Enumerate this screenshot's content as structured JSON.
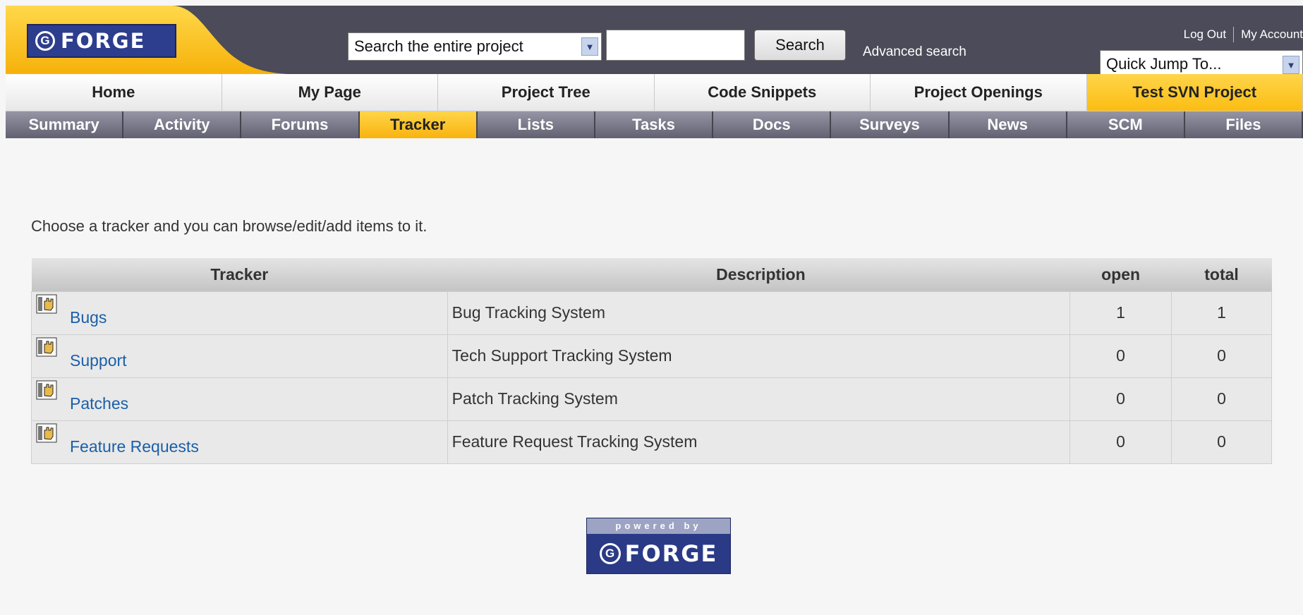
{
  "brand": {
    "logo_mark": "G",
    "logo_text": "FORGE"
  },
  "search": {
    "scope_selected": "Search the entire project",
    "query": "",
    "button_label": "Search",
    "advanced_link": "Advanced search"
  },
  "account": {
    "logout": "Log Out",
    "my_account": "My Account",
    "quick_jump": "Quick Jump To..."
  },
  "main_tabs": [
    {
      "label": "Home"
    },
    {
      "label": "My Page"
    },
    {
      "label": "Project Tree"
    },
    {
      "label": "Code Snippets"
    },
    {
      "label": "Project Openings"
    },
    {
      "label": "Test SVN Project",
      "active": true
    }
  ],
  "sub_tabs": [
    {
      "label": "Summary"
    },
    {
      "label": "Activity"
    },
    {
      "label": "Forums"
    },
    {
      "label": "Tracker",
      "active": true
    },
    {
      "label": "Lists"
    },
    {
      "label": "Tasks"
    },
    {
      "label": "Docs"
    },
    {
      "label": "Surveys"
    },
    {
      "label": "News"
    },
    {
      "label": "SCM"
    },
    {
      "label": "Files"
    }
  ],
  "intro": "Choose a tracker and you can browse/edit/add items to it.",
  "table": {
    "headers": {
      "tracker": "Tracker",
      "description": "Description",
      "open": "open",
      "total": "total"
    },
    "rows": [
      {
        "name": "Bugs",
        "description": "Bug Tracking System",
        "open": "1",
        "total": "1"
      },
      {
        "name": "Support",
        "description": "Tech Support Tracking System",
        "open": "0",
        "total": "0"
      },
      {
        "name": "Patches",
        "description": "Patch Tracking System",
        "open": "0",
        "total": "0"
      },
      {
        "name": "Feature Requests",
        "description": "Feature Request Tracking System",
        "open": "0",
        "total": "0"
      }
    ]
  },
  "footer": {
    "powered_by": "powered by",
    "logo_mark": "G",
    "logo_text": "FORGE"
  },
  "colors": {
    "accent": "#fbbd13",
    "header": "#4b4b59",
    "link": "#1a5fa8",
    "logo_blue": "#2d3e8e"
  },
  "icons": {
    "tracker_row": "tracker-hand-icon",
    "dropdown": "chevron-down-icon"
  }
}
